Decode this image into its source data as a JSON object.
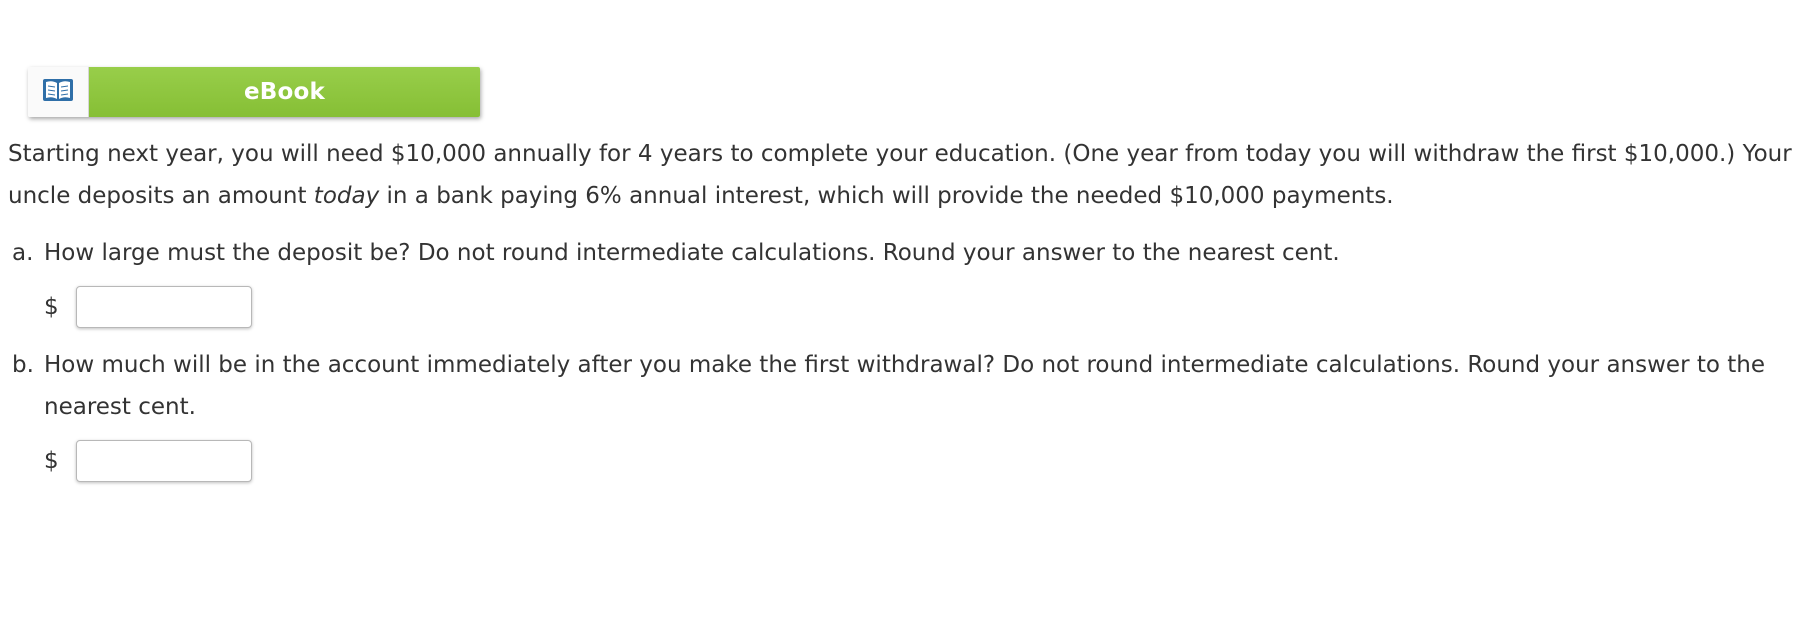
{
  "ebook": {
    "icon": "open-book-icon",
    "label": "eBook",
    "accent_color": "#8dc63f"
  },
  "problem": {
    "text_before": "Starting next year, you will need $10,000 annually for 4 years to complete your education. (One year from today you will withdraw the first $10,000.) Your uncle deposits an amount ",
    "emphasis": "today",
    "text_after": " in a bank paying 6% annual interest, which will provide the needed $10,000 payments."
  },
  "questions": [
    {
      "letter": "a.",
      "text": "How large must the deposit be? Do not round intermediate calculations. Round your answer to the nearest cent.",
      "currency": "$",
      "value": ""
    },
    {
      "letter": "b.",
      "text": "How much will be in the account immediately after you make the first withdrawal? Do not round intermediate calculations. Round your answer to the nearest cent.",
      "currency": "$",
      "value": ""
    }
  ]
}
